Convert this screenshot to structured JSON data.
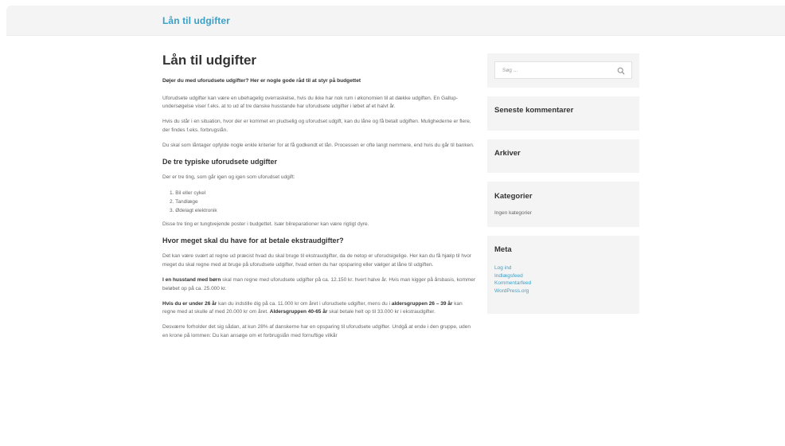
{
  "header": {
    "site_title": "Lån til udgifter"
  },
  "post": {
    "title": "Lån til udgifter",
    "lead": "Døjer du med uforudsete udgifter? Her er nogle gode råd til at styr på budgettet",
    "p1": "Uforudsete udgifter kan være en ubehagelig overraskelse, hvis du ikke har nok rum i økonomien til at dække udgiften. En Gallup-undersøgelse viser f.eks. at to ud af tre danske husstande har uforudsete udgifter i løbet af et halvt år.",
    "p2": "Hvis du står i en situation, hvor der er kommet en pludselig og uforudset udgift, kan du låne og få betalt udgiften. Mulighederne er flere, der findes f.eks. forbrugslån.",
    "p3": "Du skal som låntager opfylde nogle enkle kriterier for at få godkendt et lån. Processen er ofte langt nemmere, end hvis du går til banken.",
    "h2_1": "De tre typiske uforudsete udgifter",
    "p4": "Der er tre ting, som går igen og igen som uforudset udgift:",
    "list": [
      "1. Bil eller cykel",
      "2. Tandlæge",
      "3. Ødelagt elektronik"
    ],
    "p5": "Disse tre ting er tungtvejende poster i budgettet. Især bilreparationer kan være rigtigt dyre.",
    "h2_2": "Hvor meget skal du have for at betale ekstraudgifter?",
    "p6": "Det kan være svært at regne ud præcist hvad du skal bruge til ekstraudgifter, da de netop er uforudsigelige. Her kan du få hjælp til hvor meget du skal regne med at bruge på uforudsete udgifter, hvad enten du har opsparing eller vælger at låne til udgiften.",
    "p7_bold": "I en husstand med børn",
    "p7_rest": " skal man regne med uforudsete udgifter på ca. 12.150 kr. hvert halve år. Hvis man kigger på årsbasis, kommer beløbet op på ca. 25.000 kr.",
    "p8_bold1": "Hvis du er under 26 år",
    "p8_mid1": " kan du indstille dig på ca. 11.000 kr om året i uforudsete udgifter, mens du i ",
    "p8_bold2": "aldersgruppen 26 – 39 år",
    "p8_mid2": " kan regne med at skulle af med 20.000 kr om året. ",
    "p8_bold3": "Aldersgruppen 40-65 år",
    "p8_end": " skal betale helt op til 33.000 kr i ekstraudgifter.",
    "p9": "Desværre forholder det sig sådan, at kun 28% af danskerne har en opsparing til uforudsete udgifter. Undgå at ende i den gruppe, uden en krone på lommen: Du kan ansøge om et forbrugslån med fornuftige vilkår"
  },
  "sidebar": {
    "search_placeholder": "Søg ...",
    "recent_comments": "Seneste kommentarer",
    "archives": "Arkiver",
    "categories_title": "Kategorier",
    "categories_empty": "Ingen kategorier",
    "meta_title": "Meta",
    "meta_links": [
      "Log ind",
      "Indlægsfeed",
      "Kommentarfeed",
      "WordPress.org"
    ]
  },
  "colors": {
    "accent": "#3aa0c8",
    "panel": "#f4f4f5",
    "heading": "#333333",
    "text": "#666666"
  }
}
